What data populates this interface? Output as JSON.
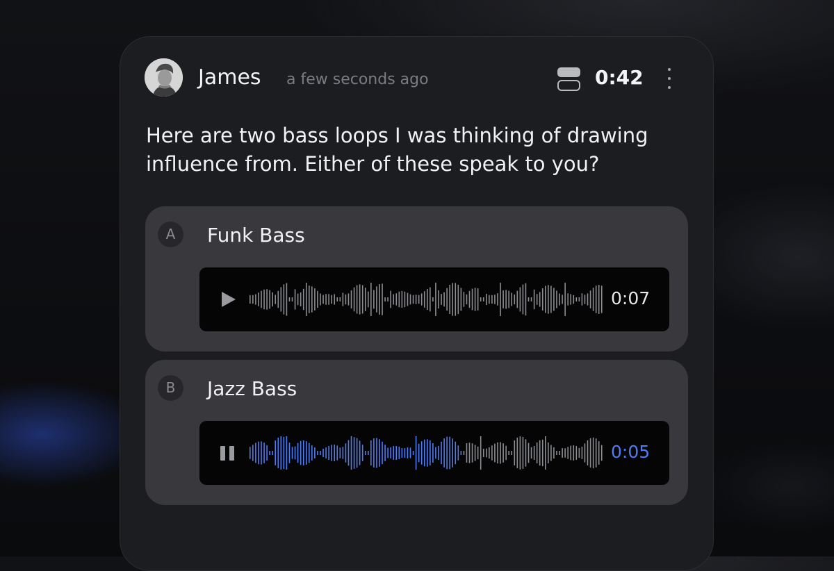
{
  "post": {
    "author": "James",
    "timestamp": "a few seconds ago",
    "duration": "0:42",
    "message": "Here are two bass loops I was thinking of drawing influence from. Either of these speak to you?"
  },
  "options": [
    {
      "letter": "A",
      "title": "Funk Bass",
      "time": "0:07",
      "state": "paused",
      "progress": 0
    },
    {
      "letter": "B",
      "title": "Jazz Bass",
      "time": "0:05",
      "state": "playing",
      "progress": 0.6
    }
  ],
  "colors": {
    "accent": "#4f7cf3",
    "card": "#1c1d20",
    "option": "#38383d",
    "player": "#050506",
    "wave_idle": "#8c8d92"
  },
  "icons": [
    "layout-toggle-icon",
    "more-vertical-icon",
    "play-icon",
    "pause-icon"
  ]
}
